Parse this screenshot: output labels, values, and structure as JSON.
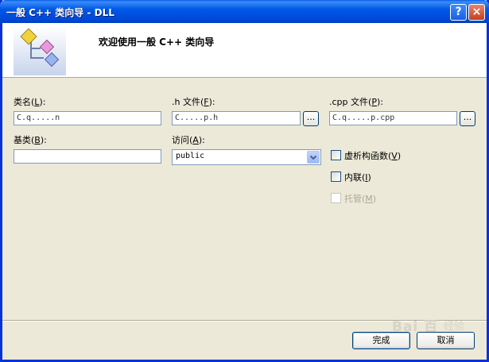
{
  "window": {
    "title": "一般 C++ 类向导 - DLL",
    "help_symbol": "?",
    "close_symbol": "×"
  },
  "banner": {
    "title": "欢迎使用一般 C++ 类向导"
  },
  "form": {
    "class_name": {
      "label": "类名",
      "accel": "L",
      "value": "C.q.....n"
    },
    "h_file": {
      "label": ".h 文件",
      "accel": "F",
      "value": "C.....p.h",
      "browse": "..."
    },
    "cpp_file": {
      "label": ".cpp 文件",
      "accel": "P",
      "value": "C.q.....p.cpp",
      "browse": "..."
    },
    "base_class": {
      "label": "基类",
      "accel": "B",
      "value": ""
    },
    "access": {
      "label": "访问",
      "accel": "A",
      "value": "public"
    }
  },
  "checkboxes": {
    "virtual_dtor": {
      "label": "虚析构函数",
      "accel": "V",
      "checked": false,
      "enabled": true
    },
    "inline": {
      "label": "内联",
      "accel": "I",
      "checked": false,
      "enabled": true
    },
    "managed": {
      "label": "托管",
      "accel": "M",
      "checked": false,
      "enabled": false
    }
  },
  "buttons": {
    "finish": "完成",
    "cancel": "取消"
  },
  "watermark": {
    "logo": "Bai 百",
    "sub": "经验"
  },
  "colors": {
    "title_blue": "#0058e6",
    "dialog_bg": "#ece9d8",
    "field_border": "#7f9db9",
    "disabled_text": "#aca899"
  }
}
